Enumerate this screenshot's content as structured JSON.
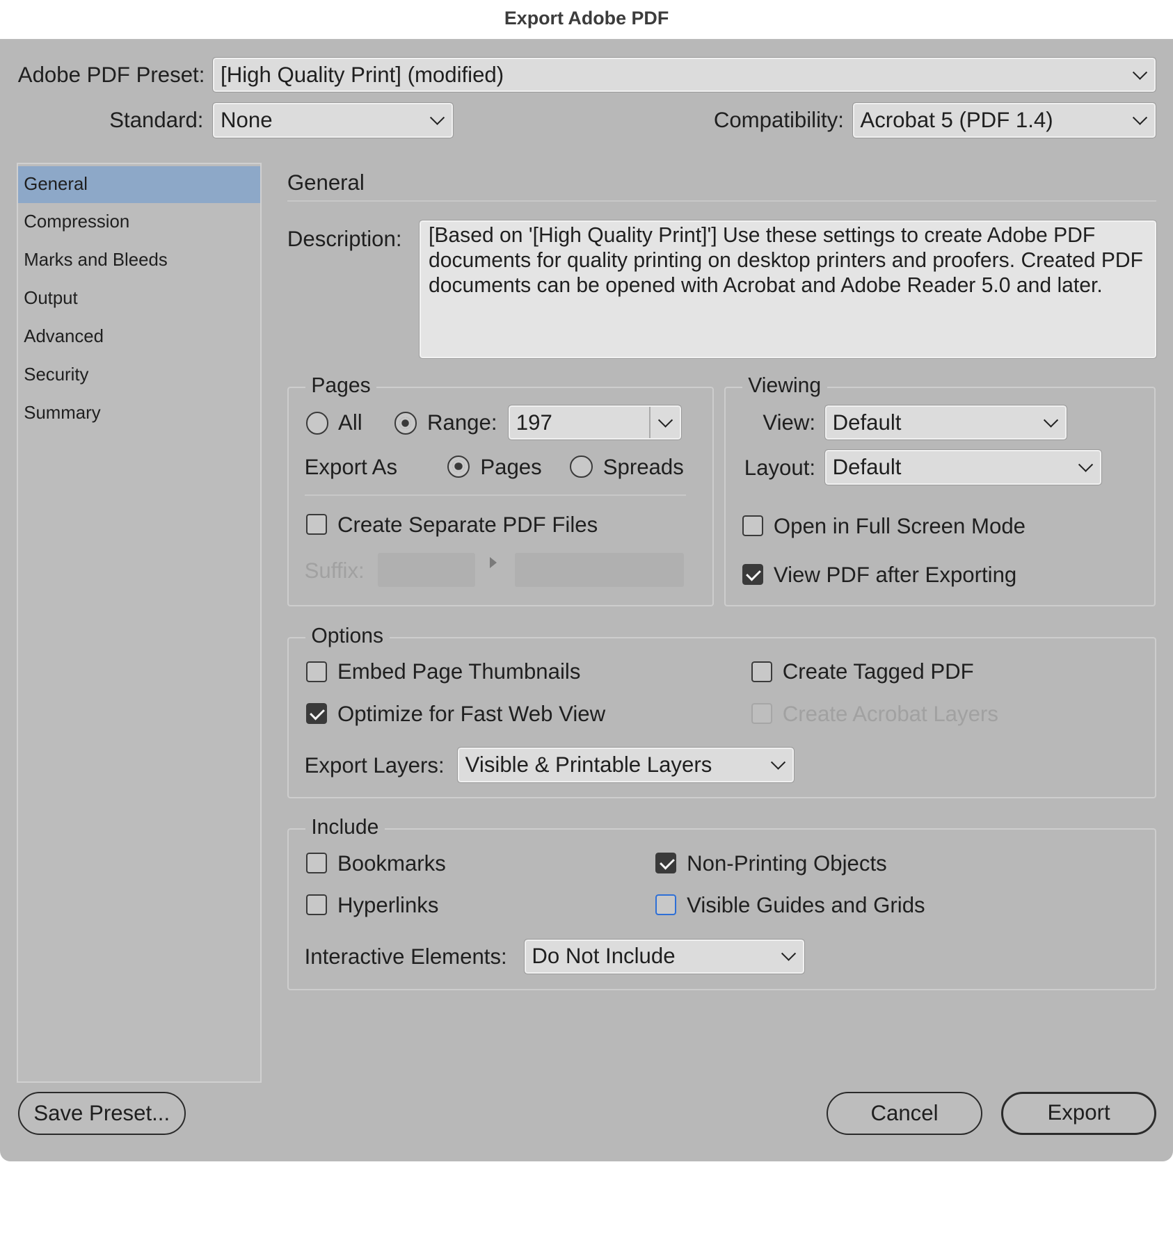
{
  "window": {
    "title": "Export Adobe PDF"
  },
  "header": {
    "preset_label": "Adobe PDF Preset:",
    "preset_value": "[High Quality Print] (modified)",
    "standard_label": "Standard:",
    "standard_value": "None",
    "compat_label": "Compatibility:",
    "compat_value": "Acrobat 5 (PDF 1.4)"
  },
  "sidebar": {
    "items": [
      {
        "label": "General",
        "selected": true
      },
      {
        "label": "Compression"
      },
      {
        "label": "Marks and Bleeds"
      },
      {
        "label": "Output"
      },
      {
        "label": "Advanced"
      },
      {
        "label": "Security"
      },
      {
        "label": "Summary"
      }
    ]
  },
  "general": {
    "title": "General",
    "description_label": "Description:",
    "description_text": "[Based on '[High Quality Print]'] Use these settings to create Adobe PDF documents for quality printing on desktop printers and proofers. Created PDF documents can be opened with Acrobat and Adobe Reader 5.0 and later."
  },
  "pages": {
    "legend": "Pages",
    "all_label": "All",
    "range_label": "Range:",
    "range_value": "197",
    "export_as_label": "Export As",
    "pages_label": "Pages",
    "spreads_label": "Spreads",
    "separate_label": "Create Separate PDF Files",
    "suffix_label": "Suffix:"
  },
  "viewing": {
    "legend": "Viewing",
    "view_label": "View:",
    "view_value": "Default",
    "layout_label": "Layout:",
    "layout_value": "Default",
    "fullscreen_label": "Open in Full Screen Mode",
    "view_after_label": "View PDF after Exporting"
  },
  "options": {
    "legend": "Options",
    "thumbnails_label": "Embed Page Thumbnails",
    "fastweb_label": "Optimize for Fast Web View",
    "tagged_label": "Create Tagged PDF",
    "acrobat_layers_label": "Create Acrobat Layers",
    "export_layers_label": "Export Layers:",
    "export_layers_value": "Visible & Printable Layers"
  },
  "include": {
    "legend": "Include",
    "bookmarks_label": "Bookmarks",
    "hyperlinks_label": "Hyperlinks",
    "nonprinting_label": "Non-Printing Objects",
    "guides_label": "Visible Guides and Grids",
    "interactive_label": "Interactive Elements:",
    "interactive_value": "Do Not Include"
  },
  "footer": {
    "save_preset": "Save Preset...",
    "cancel": "Cancel",
    "export": "Export"
  },
  "colors": {
    "dialog_bg": "#b8b8b8",
    "selected_item": "#8da8c8",
    "focus_blue": "#2e6fd6"
  }
}
